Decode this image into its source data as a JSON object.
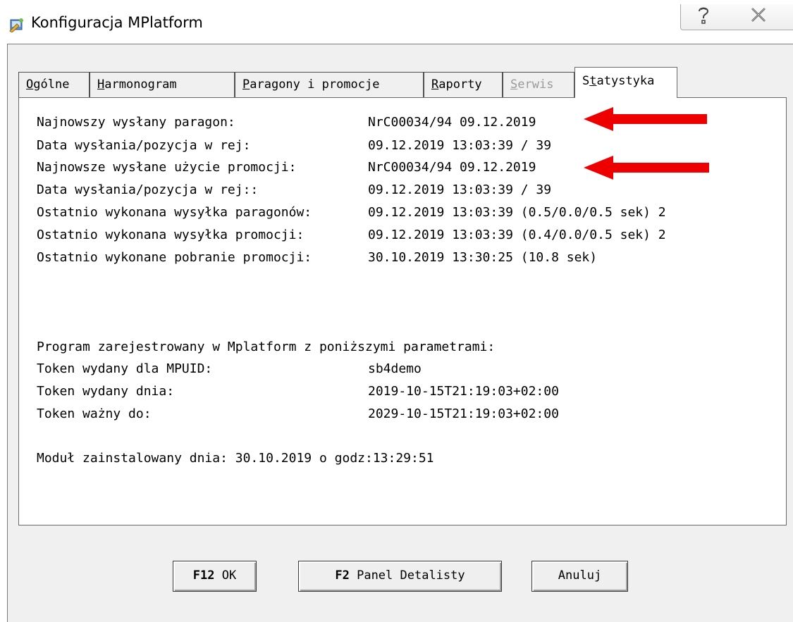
{
  "window": {
    "title": "Konfiguracja MPlatform"
  },
  "tabs": [
    {
      "label": "Ogólne",
      "active": false,
      "disabled": false
    },
    {
      "label": "Harmonogram",
      "active": false,
      "disabled": false
    },
    {
      "label": "Paragony i promocje",
      "active": false,
      "disabled": false
    },
    {
      "label": "Raporty",
      "active": false,
      "disabled": false
    },
    {
      "label": "Serwis",
      "active": false,
      "disabled": true
    },
    {
      "label": "Statystyka",
      "active": true,
      "disabled": false
    }
  ],
  "stats": [
    {
      "label": "Najnowszy wysłany paragon:",
      "value": "NrC00034/94 09.12.2019"
    },
    {
      "label": "Data wysłania/pozycja w rej:",
      "value": "09.12.2019 13:03:39 / 39"
    },
    {
      "label": "Najnowsze wysłane użycie promocji:",
      "value": "NrC00034/94 09.12.2019"
    },
    {
      "label": "Data wysłania/pozycja w rej::",
      "value": "09.12.2019 13:03:39 / 39"
    },
    {
      "label": "Ostatnio wykonana wysyłka paragonów:",
      "value": "09.12.2019 13:03:39 (0.5/0.0/0.5 sek) 2"
    },
    {
      "label": "Ostatnio wykonana wysyłka promocji:",
      "value": "09.12.2019 13:03:39 (0.4/0.0/0.5 sek) 2"
    },
    {
      "label": "Ostatnio wykonane pobranie promocji:",
      "value": "30.10.2019 13:30:25 (10.8 sek)"
    }
  ],
  "registration": {
    "heading": "Program zarejestrowany w Mplatform z poniższymi parametrami:",
    "rows": [
      {
        "label": "Token wydany dla MPUID:",
        "value": "sb4demo"
      },
      {
        "label": "Token wydany dnia:",
        "value": "2019-10-15T21:19:03+02:00"
      },
      {
        "label": "Token ważny do:",
        "value": "2029-10-15T21:19:03+02:00"
      }
    ]
  },
  "install_line": "Moduł zainstalowany dnia: 30.10.2019 o godz:13:29:51",
  "buttons": {
    "ok": {
      "key": "F12",
      "label": "OK"
    },
    "panel": {
      "key": "F2",
      "label": "Panel Detalisty"
    },
    "cancel": {
      "label": "Anuluj"
    }
  },
  "colors": {
    "arrow": "#ee0000",
    "disabled_text": "#9a9a9a",
    "dialog_bg": "#f0f0f0"
  }
}
